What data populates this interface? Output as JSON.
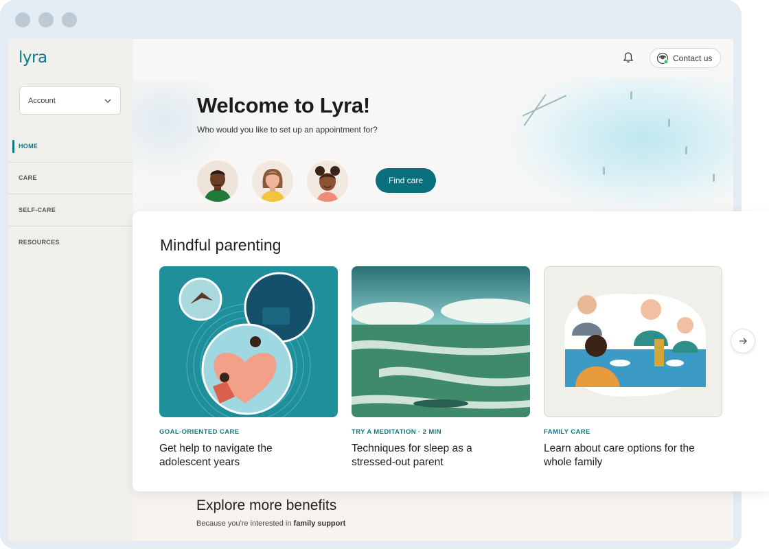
{
  "app": {
    "logo": "lyra"
  },
  "sidebar": {
    "account_label": "Account",
    "items": [
      {
        "label": "HOME",
        "active": true
      },
      {
        "label": "CARE",
        "active": false
      },
      {
        "label": "SELF-CARE",
        "active": false
      },
      {
        "label": "RESOURCES",
        "active": false
      }
    ]
  },
  "header": {
    "contact_label": "Contact us",
    "bell_icon": "bell-icon",
    "contact_icon": "headset-icon"
  },
  "hero": {
    "title": "Welcome to Lyra!",
    "subtitle": "Who would you like to set up an appointment for?",
    "avatars": [
      "adult-man-avatar",
      "adult-woman-avatar",
      "child-avatar"
    ],
    "find_care_label": "Find care"
  },
  "panel": {
    "title": "Mindful parenting",
    "cards": [
      {
        "tag": "GOAL-ORIENTED CARE",
        "title": "Get help to navigate the adolescent years"
      },
      {
        "tag": "TRY A MEDITATION · 2 MIN",
        "title": "Techniques for sleep as a stressed-out parent"
      },
      {
        "tag": "FAMILY CARE",
        "title": "Learn about care options for the whole family"
      }
    ],
    "next_icon": "arrow-right-icon"
  },
  "explore": {
    "title": "Explore more benefits",
    "subtitle_prefix": "Because you're interested in ",
    "subtitle_emphasis": "family support"
  },
  "colors": {
    "accent": "#0a7b86",
    "button": "#0a6f7d",
    "sidebar_bg": "#f1efeb"
  }
}
